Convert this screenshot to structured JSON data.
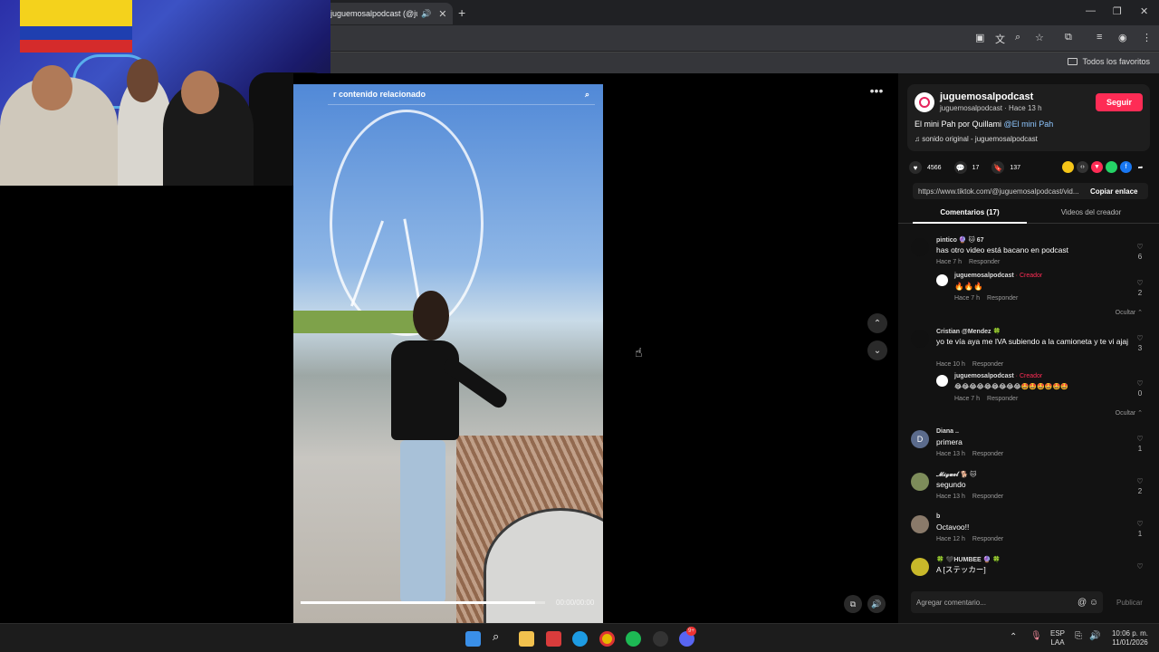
{
  "browser": {
    "tab_title": "juguemosalpodcast (@jugu",
    "tab_close": "✕",
    "new_tab": "+",
    "bookmarks_label": "Todos los favoritos"
  },
  "video": {
    "search_text": "r contenido relacionado",
    "time": "00:00/00:00",
    "progress": 0.96
  },
  "post": {
    "author": "juguemosalpodcast",
    "author_sub": "juguemosalpodcast · Hace 13 h",
    "follow": "Seguir",
    "description": "El mini Pah por Quillami ",
    "mention": "@El mini Pah",
    "sound": "sonido original - juguemosalpodcast",
    "likes": "4566",
    "comments": "17",
    "saves": "137",
    "link": "https://www.tiktok.com/@juguemosalpodcast/vid...",
    "copy": "Copiar enlace"
  },
  "tabs": {
    "comments": "Comentarios (17)",
    "creator_videos": "Videos del creador"
  },
  "comments": [
    {
      "name": "pintico 🔮 🐱 67",
      "text": "has otro video está bacano en podcast",
      "time": "Hace 7 h",
      "reply": "Responder",
      "likes": "6"
    },
    {
      "name": "juguemosalpodcast",
      "creator": " · Creador",
      "text": "🔥🔥🔥",
      "time": "Hace 7 h",
      "reply": "Responder",
      "likes": "2"
    },
    {
      "name": "Cristian @Mendez 🍀",
      "text": "yo te vía aya me IVA subiendo a la camioneta y te vi ajaj",
      "time": "Hace 10 h",
      "reply": "Responder",
      "likes": "3"
    },
    {
      "name": "juguemosalpodcast",
      "creator": " · Creador",
      "text": "😂😂😂😂😂😂😂😂😂🤩🤩🤩🤩🤩🤩",
      "time": "Hace 7 h",
      "reply": "Responder",
      "likes": "0"
    },
    {
      "name": "Diana ..",
      "text": "primera",
      "time": "Hace 13 h",
      "reply": "Responder",
      "likes": "1"
    },
    {
      "name": "𝓜𝓲𝓰𝓾𝓮𝓵 🐕 🐱",
      "text": "segundo",
      "time": "Hace 13 h",
      "reply": "Responder",
      "likes": "2"
    },
    {
      "name": "b",
      "text": "Octavoo!!",
      "time": "Hace 12 h",
      "reply": "Responder",
      "likes": "1"
    },
    {
      "name": "🍀 🖤HUMBEE 🔮 🍀",
      "text": "A [ステッカー]",
      "time": "",
      "reply": "",
      "likes": ""
    }
  ],
  "hide_label": "Ocultar ⌃",
  "diana_initial": "D",
  "comment_box": {
    "placeholder": "Agregar comentario...",
    "publish": "Publicar"
  },
  "taskbar": {
    "lang": "ESP",
    "lang2": "LAA",
    "time": "10:06 p. m.",
    "date": "11/01/2026",
    "chat_badge": "9+"
  },
  "colors": {
    "accent": "#fe2c55",
    "panel": "#121212"
  }
}
